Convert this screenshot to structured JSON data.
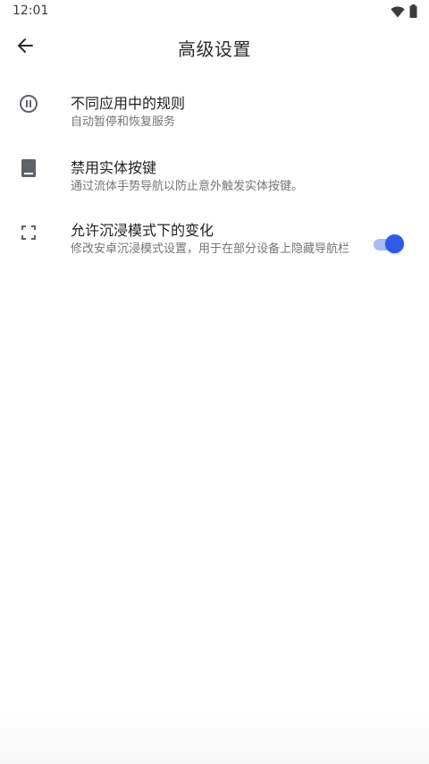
{
  "status_bar": {
    "time": "12:01",
    "icons": [
      "wifi-icon",
      "battery-icon"
    ]
  },
  "app_bar": {
    "title": "高级设置",
    "back_icon": "arrow-back-icon"
  },
  "settings": [
    {
      "icon": "pause-circle-icon",
      "title": "不同应用中的规则",
      "subtitle": "自动暂停和恢复服务"
    },
    {
      "icon": "phone-hardware-key-icon",
      "title": "禁用实体按键",
      "subtitle": "通过流体手势导航以防止意外触发实体按键。"
    },
    {
      "icon": "fullscreen-icon",
      "title": "允许沉浸模式下的变化",
      "subtitle": "修改安卓沉浸模式设置，用于在部分设备上隐藏导航栏",
      "toggle_on": true
    }
  ],
  "colors": {
    "accent": "#2f5ae8",
    "accent_track": "#a9bdf4",
    "subtitle": "#757575",
    "icon": "#5f6368"
  }
}
